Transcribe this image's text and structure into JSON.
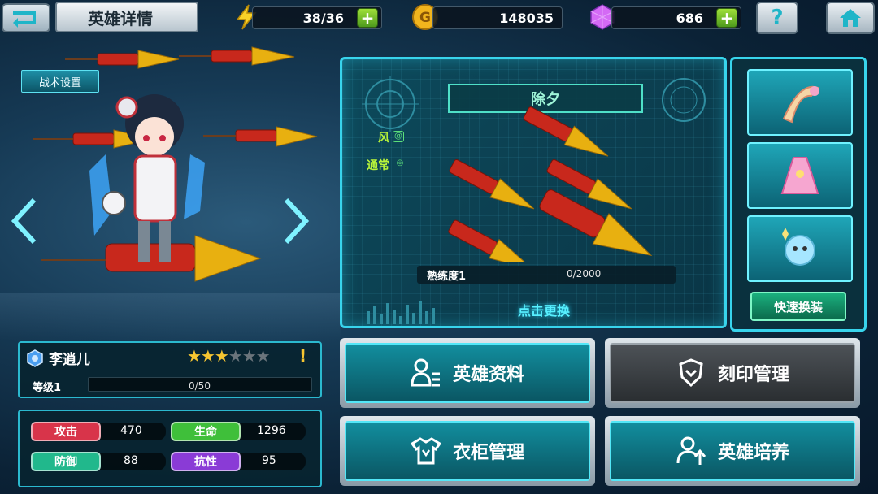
{
  "header": {
    "title": "英雄详情",
    "stamina": "38/36",
    "gold": "148035",
    "gems": "686",
    "plus_label": "+",
    "help_label": "?"
  },
  "hero": {
    "tactic_label": "战术设置",
    "name": "李逍儿",
    "stars_on": "★★★",
    "stars_off": "★★★",
    "stars_filled": 3,
    "stars_total": 6,
    "warning": "!",
    "level_label": "等级1",
    "exp": "0/50",
    "exp_fraction": 0
  },
  "weapon": {
    "name": "除夕",
    "element": "风",
    "rarity": "通常",
    "proficiency_label": "熟练度1",
    "proficiency_value": "0/2000",
    "change_label": "点击更换"
  },
  "gear": {
    "quick_change_label": "快速换装"
  },
  "stats": [
    {
      "label": "攻击",
      "value": "470",
      "color": "#d8344a"
    },
    {
      "label": "生命",
      "value": "1296",
      "color": "#3fbf3a"
    },
    {
      "label": "防御",
      "value": "88",
      "color": "#21b88c"
    },
    {
      "label": "抗性",
      "value": "95",
      "color": "#8a3bd6"
    }
  ],
  "menu": {
    "hero_info": "英雄资料",
    "imprint": "刻印管理",
    "wardrobe": "衣柜管理",
    "training": "英雄培养"
  },
  "colors": {
    "accent": "#38d4ec",
    "panel": "#0a3545",
    "star": "#f7c631"
  }
}
